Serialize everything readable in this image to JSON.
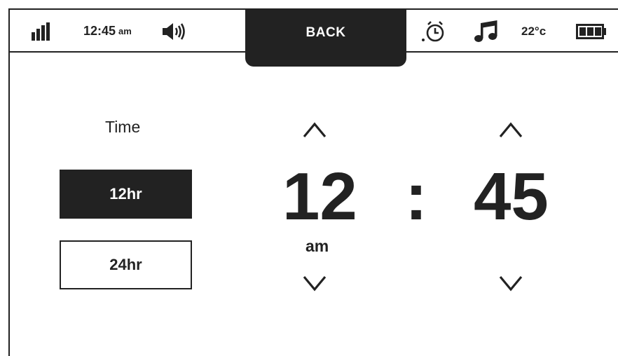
{
  "status_bar": {
    "signal_icon": "signal-bars-icon",
    "time": "12:45",
    "ampm": "am",
    "volume_icon": "speaker-icon",
    "back_label": "BACK",
    "alarm_icon": "alarm-clock-icon",
    "music_icon": "music-note-icon",
    "temperature": "22°c",
    "battery_icon": "battery-icon",
    "battery_level": 1.0
  },
  "time_settings": {
    "title": "Time",
    "format_options": [
      "12hr",
      "24hr"
    ],
    "selected_format": "12hr"
  },
  "clock_setter": {
    "hours": "12",
    "separator": ":",
    "minutes": "45",
    "period": "am"
  },
  "colors": {
    "dark": "#222222",
    "background": "#ffffff"
  }
}
